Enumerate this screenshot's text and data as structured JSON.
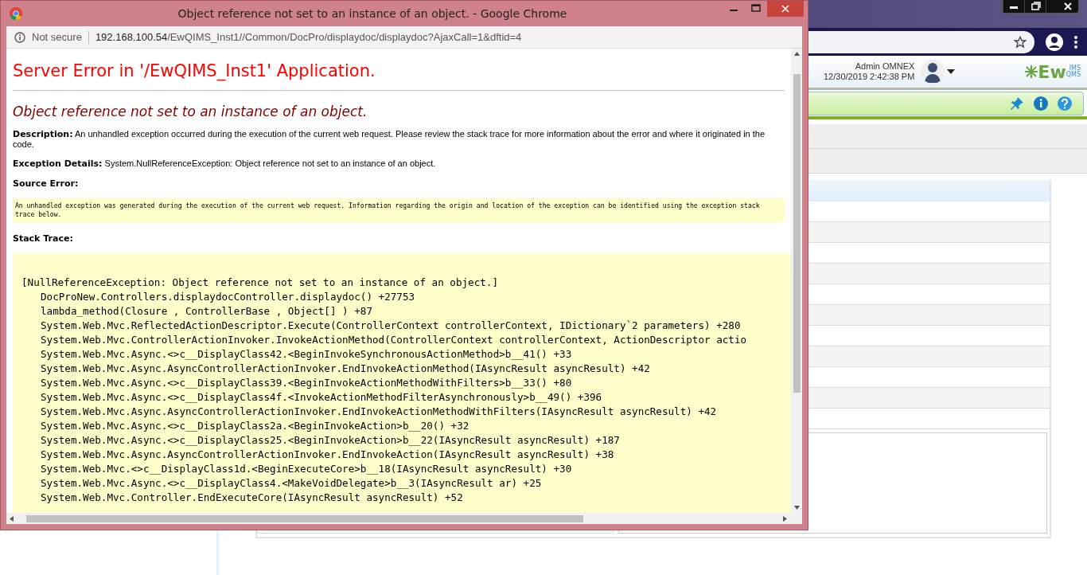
{
  "background_page": {
    "user_name": "Admin OMNEX",
    "datetime": "12/30/2019 2:42:38 PM",
    "logo": {
      "main": "Ew",
      "upper": "IMS",
      "lower": "QMS"
    }
  },
  "popup": {
    "title": "Object reference not set to an instance of an object. - Google Chrome",
    "address": {
      "security": "Not secure",
      "host": "192.168.100.54",
      "path": "/EwQIMS_Inst1//Common/DocPro/displaydoc/displaydoc?AjaxCall=1&dftid=4"
    },
    "error": {
      "heading": "Server Error in '/EwQIMS_Inst1' Application.",
      "message": "Object reference not set to an instance of an object.",
      "description": "**Description:** An unhandled exception occurred during the execution of the current web request. Please review the stack trace for more information about the error and where it originated in the code.",
      "exception_details": "**Exception Details:** System.NullReferenceException: Object reference not set to an instance of an object.",
      "source_error_label": "Source Error:",
      "source_error": "An unhandled exception was generated during the execution of the current web request. Information regarding the origin and location of the exception can be identified using the exception stack trace below.",
      "stack_trace_label": "Stack Trace:",
      "exception": "[NullReferenceException: Object reference not set to an instance of an object.]",
      "frames": [
        "DocProNew.Controllers.displaydocController.displaydoc() +27753",
        "lambda_method(Closure , ControllerBase , Object[] ) +87",
        "System.Web.Mvc.ReflectedActionDescriptor.Execute(ControllerContext controllerContext, IDictionary`2 parameters) +280",
        "System.Web.Mvc.ControllerActionInvoker.InvokeActionMethod(ControllerContext controllerContext, ActionDescriptor actio",
        "System.Web.Mvc.Async.<>c__DisplayClass42.<BeginInvokeSynchronousActionMethod>b__41() +33",
        "System.Web.Mvc.Async.AsyncControllerActionInvoker.EndInvokeActionMethod(IAsyncResult asyncResult) +42",
        "System.Web.Mvc.Async.<>c__DisplayClass39.<BeginInvokeActionMethodWithFilters>b__33() +80",
        "System.Web.Mvc.Async.<>c__DisplayClass4f.<InvokeActionMethodFilterAsynchronously>b__49() +396",
        "System.Web.Mvc.Async.AsyncControllerActionInvoker.EndInvokeActionMethodWithFilters(IAsyncResult asyncResult) +42",
        "System.Web.Mvc.Async.<>c__DisplayClass2a.<BeginInvokeAction>b__20() +32",
        "System.Web.Mvc.Async.<>c__DisplayClass25.<BeginInvokeAction>b__22(IAsyncResult asyncResult) +187",
        "System.Web.Mvc.Async.AsyncControllerActionInvoker.EndInvokeAction(IAsyncResult asyncResult) +38",
        "System.Web.Mvc.<>c__DisplayClass1d.<BeginExecuteCore>b__18(IAsyncResult asyncResult) +30",
        "System.Web.Mvc.Async.<>c__DisplayClass4.<MakeVoidDelegate>b__3(IAsyncResult ar) +25",
        "System.Web.Mvc.Controller.EndExecuteCore(IAsyncResult asyncResult) +52"
      ]
    }
  }
}
